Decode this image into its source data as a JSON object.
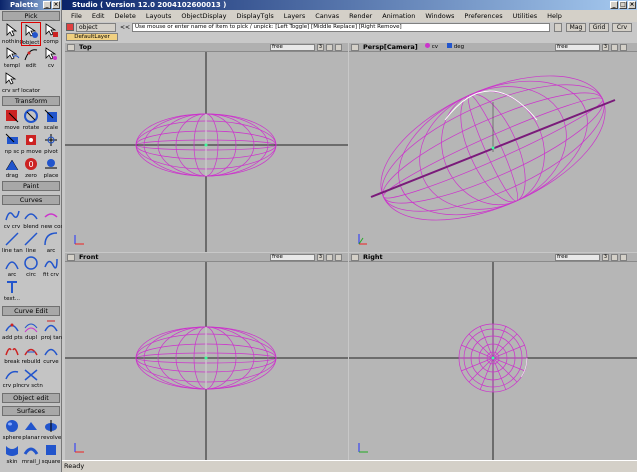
{
  "palette": {
    "title": "Palette",
    "sections": {
      "pick": "Pick",
      "transform": "Transform",
      "paint": "Paint",
      "curves": "Curves",
      "curve_edit": "Curve Edit",
      "object_edit": "Object edit",
      "surfaces": "Surfaces"
    },
    "tools": {
      "nothing": "nothing",
      "object": "object",
      "comp": "comp",
      "templ": "templ",
      "edit": "edit",
      "cv": "cv",
      "crv_srf_locator": "crv srf locator",
      "move": "move",
      "rotate": "rotate",
      "scale": "scale",
      "np_sc": "np sc",
      "p_move": "p move",
      "pivot": "pivot",
      "drag": "drag",
      "zero": "zero",
      "place": "place",
      "cv_crv": "cv crv",
      "blend": "blend",
      "new_cos": "new cos",
      "line_tan": "line tan",
      "line": "line",
      "arc": "arc",
      "arc2": "arc",
      "circ": "circ",
      "fit_crv": "fit crv",
      "text": "text...",
      "add_pts": "add pts",
      "dupl": "dupl",
      "proj_tan": "proj tan",
      "break": "break",
      "rebuild": "rebuild",
      "curve": "curve",
      "crv_pln": "crv pln",
      "crv_sctn": "crv sctn",
      "sphere": "sphere",
      "planar": "planar",
      "revolve": "revolve",
      "skin": "skin",
      "mrail_j": "mrail_j",
      "square": "square"
    }
  },
  "window": {
    "title": "Studio ( Version 12.0  2004102600013 )"
  },
  "menu": [
    "File",
    "Edit",
    "Delete",
    "Layouts",
    "ObjectDisplay",
    "DisplayTgls",
    "Layers",
    "Canvas",
    "Render",
    "Animation",
    "Windows",
    "Preferences",
    "Utilities",
    "Help"
  ],
  "toolbar": {
    "mode": "object",
    "prompt": "Use mouse or enter name of item to pick / unpick: [Left Toggle] [Middle Replace] [Right Remove]",
    "mag": "Mag",
    "grid": "Grid",
    "crv": "Crv"
  },
  "layer": {
    "name": "DefaultLayer"
  },
  "viewports": {
    "top": {
      "title": "Top",
      "field": "free",
      "num": "3"
    },
    "persp": {
      "title": "Persp[Camera]",
      "cv": "cv",
      "deg": "deg",
      "field": "free",
      "num": "3"
    },
    "front": {
      "title": "Front",
      "field": "free",
      "num": "3"
    },
    "right": {
      "title": "Right",
      "field": "free",
      "num": "3"
    }
  },
  "status": "Ready",
  "colors": {
    "wire": "#cc33cc",
    "viewport_bg": "#b6b6b6",
    "grid_axis": "#222222",
    "title_blue": "#0a246a"
  }
}
